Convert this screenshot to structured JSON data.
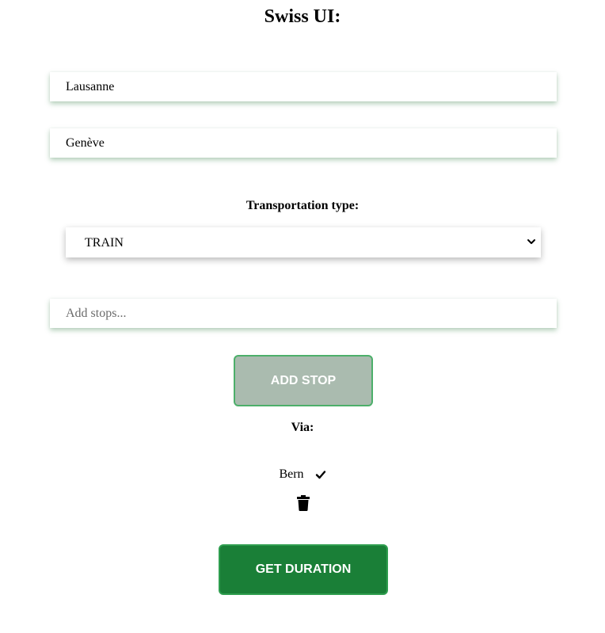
{
  "header": {
    "title": "Swiss UI:"
  },
  "form": {
    "origin": {
      "value": "Lausanne"
    },
    "destination": {
      "value": "Genève"
    },
    "transport": {
      "label": "Transportation type:",
      "selected": "TRAIN"
    },
    "stops_input": {
      "value": "",
      "placeholder": "Add stops..."
    },
    "add_stop_label": "ADD STOP",
    "via_label": "Via:",
    "via_stops": [
      {
        "name": "Bern"
      }
    ],
    "get_duration_label": "GET DURATION"
  },
  "colors": {
    "add_stop_bg": "#aabbaf",
    "add_stop_border": "#4caf6a",
    "primary_green": "#1a7f37"
  },
  "icons": {
    "select": "chevron-down-icon",
    "stop_confirm": "check-icon",
    "stop_delete": "trash-icon"
  }
}
